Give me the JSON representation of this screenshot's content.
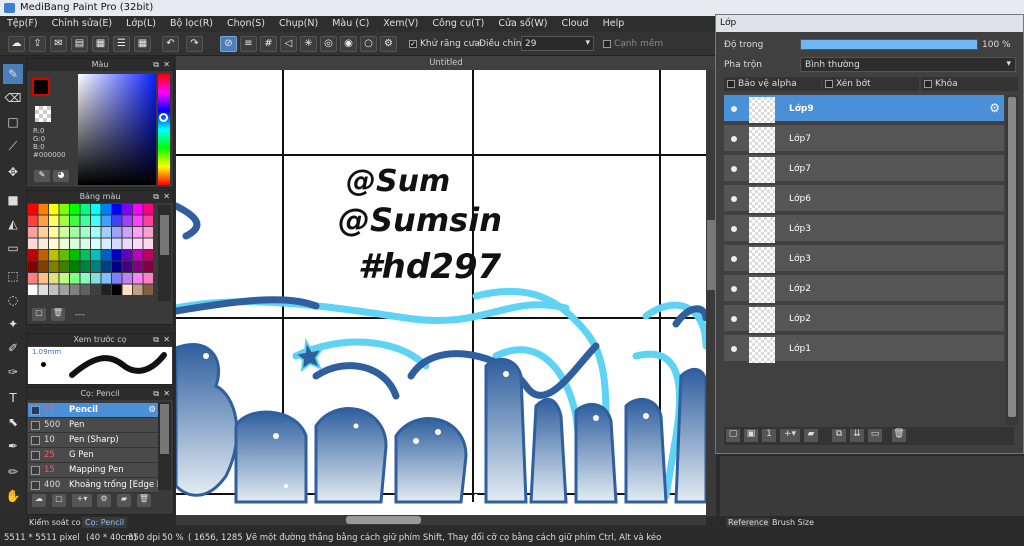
{
  "window": {
    "title": "MediBang Paint Pro (32bit)"
  },
  "menu": [
    "Tệp(F)",
    "Chỉnh sửa(E)",
    "Lớp(L)",
    "Bộ lọc(R)",
    "Chọn(S)",
    "Chụp(N)",
    "Màu (C)",
    "Xem(V)",
    "Công cụ(T)",
    "Cửa số(W)",
    "Cloud",
    "Help"
  ],
  "toolbar": {
    "antialias_label": "Khử răng cưa",
    "adjust_label": "Điều chỉnh",
    "adjust_value": "29",
    "snap_label": "Cạnh mềm"
  },
  "canvas": {
    "tab_title": "Untitled",
    "text_lines": [
      "@Sum",
      "@Sumsin",
      "#hd297"
    ]
  },
  "color_panel": {
    "title": "Màu",
    "r": "R:0",
    "g": "G:0",
    "b": "B:0",
    "hex": "#000000"
  },
  "palette_panel": {
    "title": "Bảng màu",
    "footer": "---"
  },
  "preview_panel": {
    "title": "Xem trước cọ",
    "size": "1.09mm"
  },
  "brush_panel": {
    "title": "Cọ: Pencil",
    "items": [
      {
        "size": "15",
        "name": "Pencil",
        "color": "#e23b3b"
      },
      {
        "size": "500",
        "name": "Pen",
        "color": "#000000"
      },
      {
        "size": "10",
        "name": "Pen (Sharp)",
        "color": "#000000"
      },
      {
        "size": "25",
        "name": "G Pen",
        "color": "#e23b3b"
      },
      {
        "size": "15",
        "name": "Mapping Pen",
        "color": "#e23b3b"
      },
      {
        "size": "400",
        "name": "Khoảng trống [Edge I",
        "color": "#000000"
      }
    ]
  },
  "bottom_tabs": [
    "Kiểm soát co",
    "Cọ: Pencil"
  ],
  "layers_window": {
    "title": "Lớp",
    "opacity_label": "Độ trong",
    "opacity_value": "100 %",
    "opacity_fraction": 1.0,
    "blend_label": "Pha trộn",
    "blend_value": "Bình thường",
    "protect_alpha": "Bảo vệ alpha",
    "clipping": "Xén bớt",
    "lock": "Khóa",
    "layers": [
      "Lớp9",
      "Lớp7",
      "Lớp7",
      "Lớp6",
      "Lớp3",
      "Lớp3",
      "Lớp2",
      "Lớp2",
      "Lớp1"
    ]
  },
  "right_tabs": [
    "Reference",
    "Brush Size"
  ],
  "status": {
    "size": "5511 * 5511 pixel",
    "cm": "(40 * 40cm)",
    "dpi": "350 dpi",
    "zoom": "50 %",
    "coords": "( 1656, 1285 )",
    "hint": "Vẽ một đường thẳng bằng cách giữ phím Shift, Thay đổi cỡ cọ bằng cách giữ phím Ctrl, Alt và kéo"
  },
  "colors": {
    "accent": "#4a90d9",
    "panel": "#3a3a3a",
    "canvas_blue": "#2f5f9e",
    "canvas_cyan": "#5ed3f3"
  }
}
